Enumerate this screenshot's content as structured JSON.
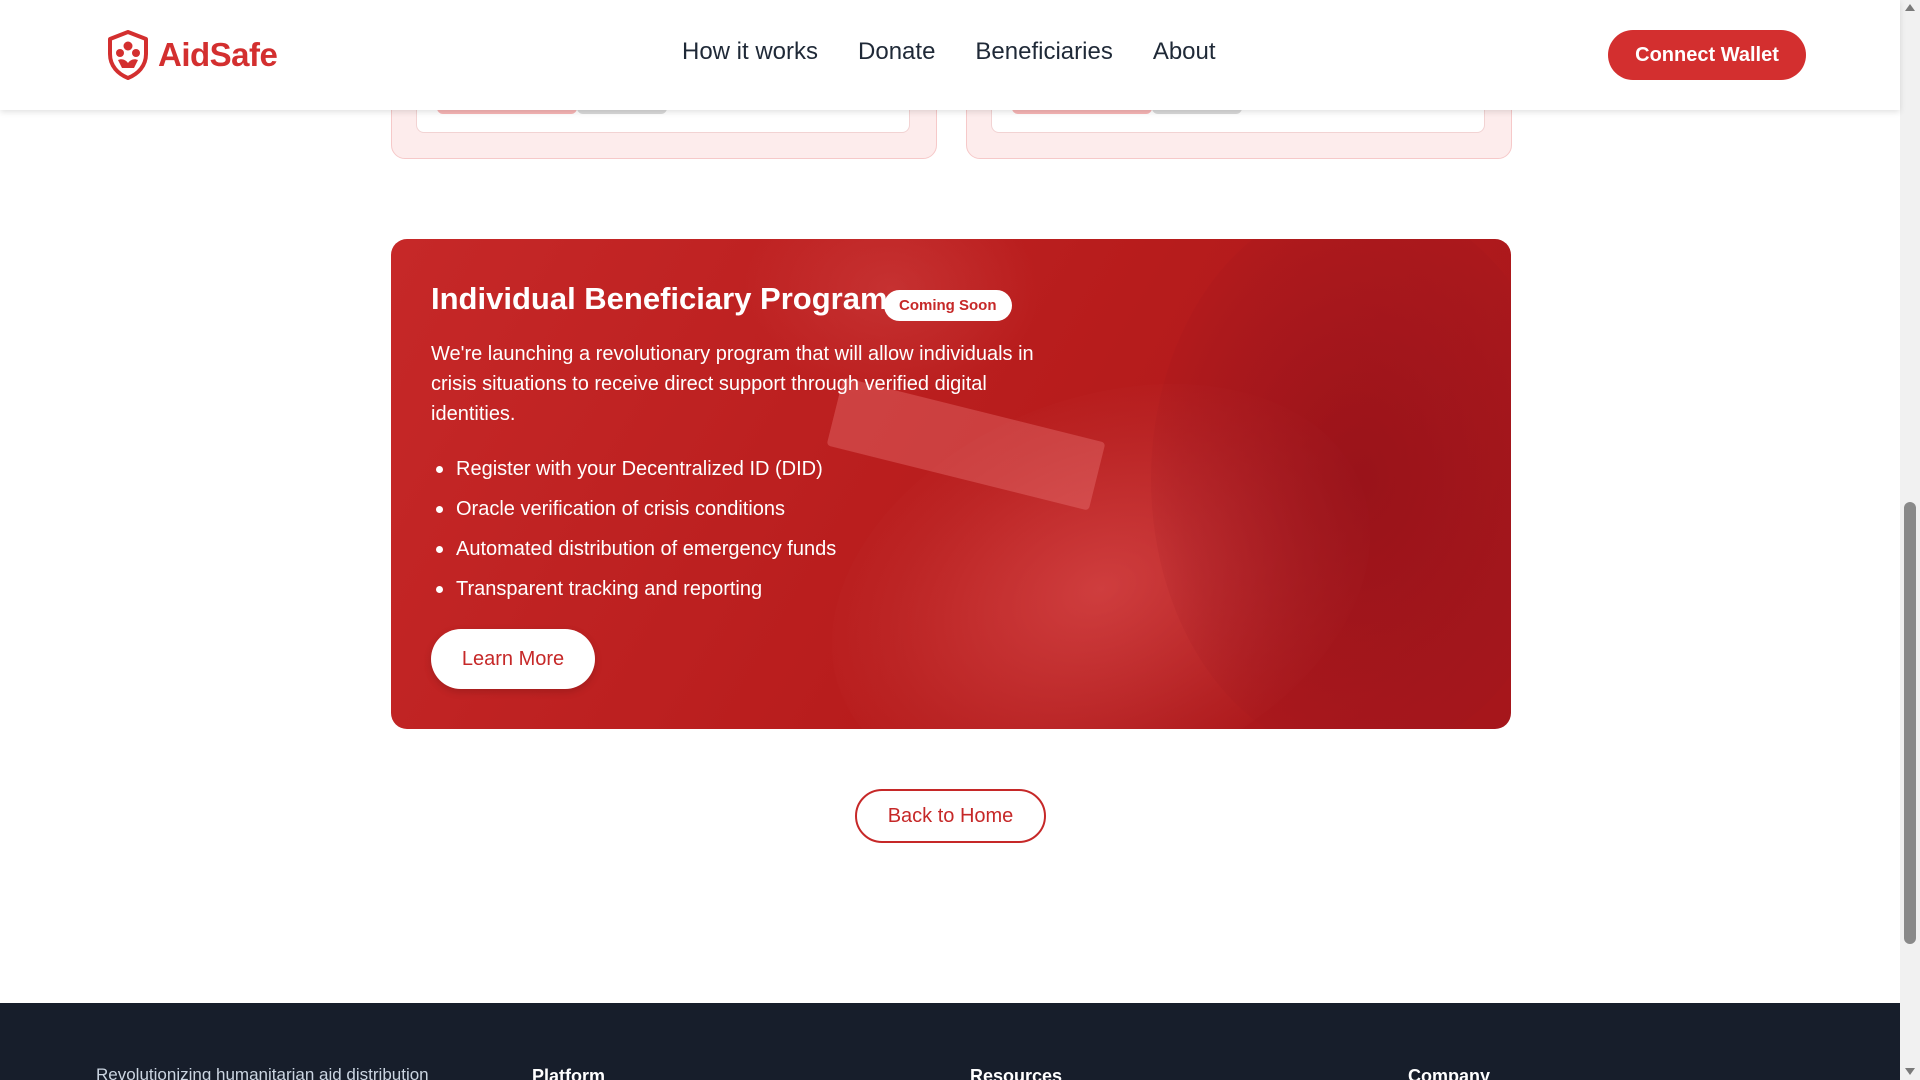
{
  "header": {
    "brand": "AidSafe",
    "nav": [
      "How it works",
      "Donate",
      "Beneficiaries",
      "About"
    ],
    "connect_label": "Connect Wallet"
  },
  "program": {
    "title": "Individual Beneficiary Program",
    "badge": "Coming Soon",
    "description": "We're launching a revolutionary program that will allow individuals in crisis situations to receive direct support through verified digital identities.",
    "bullets": [
      "Register with your Decentralized ID (DID)",
      "Oracle verification of crisis conditions",
      "Automated distribution of emergency funds",
      "Transparent tracking and reporting"
    ],
    "learn_more_label": "Learn More"
  },
  "back_label": "Back to Home",
  "footer": {
    "tagline": "Revolutionizing humanitarian aid distribution",
    "columns": [
      "Platform",
      "Resources",
      "Company"
    ]
  },
  "colors": {
    "brand": "#d32f2f",
    "footer_bg": "#171e2b"
  },
  "icons": {
    "logo": "shield-hand-icon",
    "bullet": "bullet-dot-icon"
  }
}
